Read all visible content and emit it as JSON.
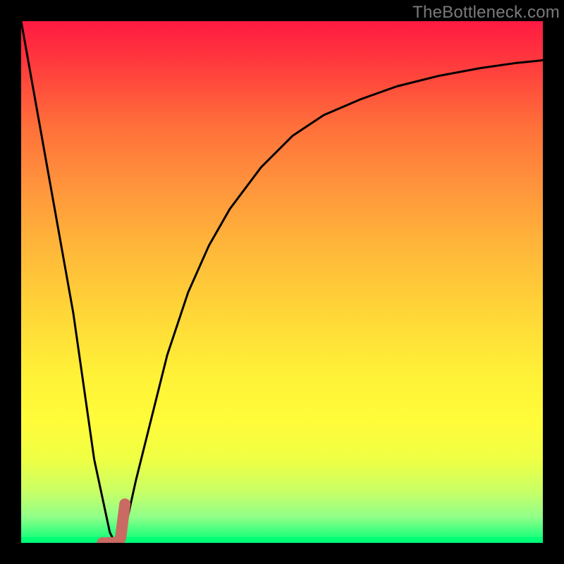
{
  "watermark": "TheBottleneck.com",
  "chart_data": {
    "type": "line",
    "title": "",
    "xlabel": "",
    "ylabel": "",
    "xlim": [
      0,
      100
    ],
    "ylim": [
      0,
      100
    ],
    "series": [
      {
        "name": "bottleneck-curve",
        "x": [
          0,
          5,
          10,
          14,
          17,
          18,
          20,
          22,
          25,
          28,
          32,
          36,
          40,
          46,
          52,
          58,
          65,
          72,
          80,
          88,
          95,
          100
        ],
        "y": [
          100,
          72,
          44,
          16,
          2,
          0,
          3,
          12,
          24,
          36,
          48,
          57,
          64,
          72,
          78,
          82,
          85,
          87.5,
          89.5,
          91,
          92,
          92.5
        ]
      }
    ],
    "marker": {
      "name": "selection-marker",
      "x": 18,
      "y": 0,
      "shape": "J",
      "color": "#c96a63"
    },
    "gradient_stops": [
      {
        "pos": 0,
        "color": "#ff1a42"
      },
      {
        "pos": 50,
        "color": "#ffd438"
      },
      {
        "pos": 80,
        "color": "#fffc3a"
      },
      {
        "pos": 100,
        "color": "#00ff76"
      }
    ]
  }
}
